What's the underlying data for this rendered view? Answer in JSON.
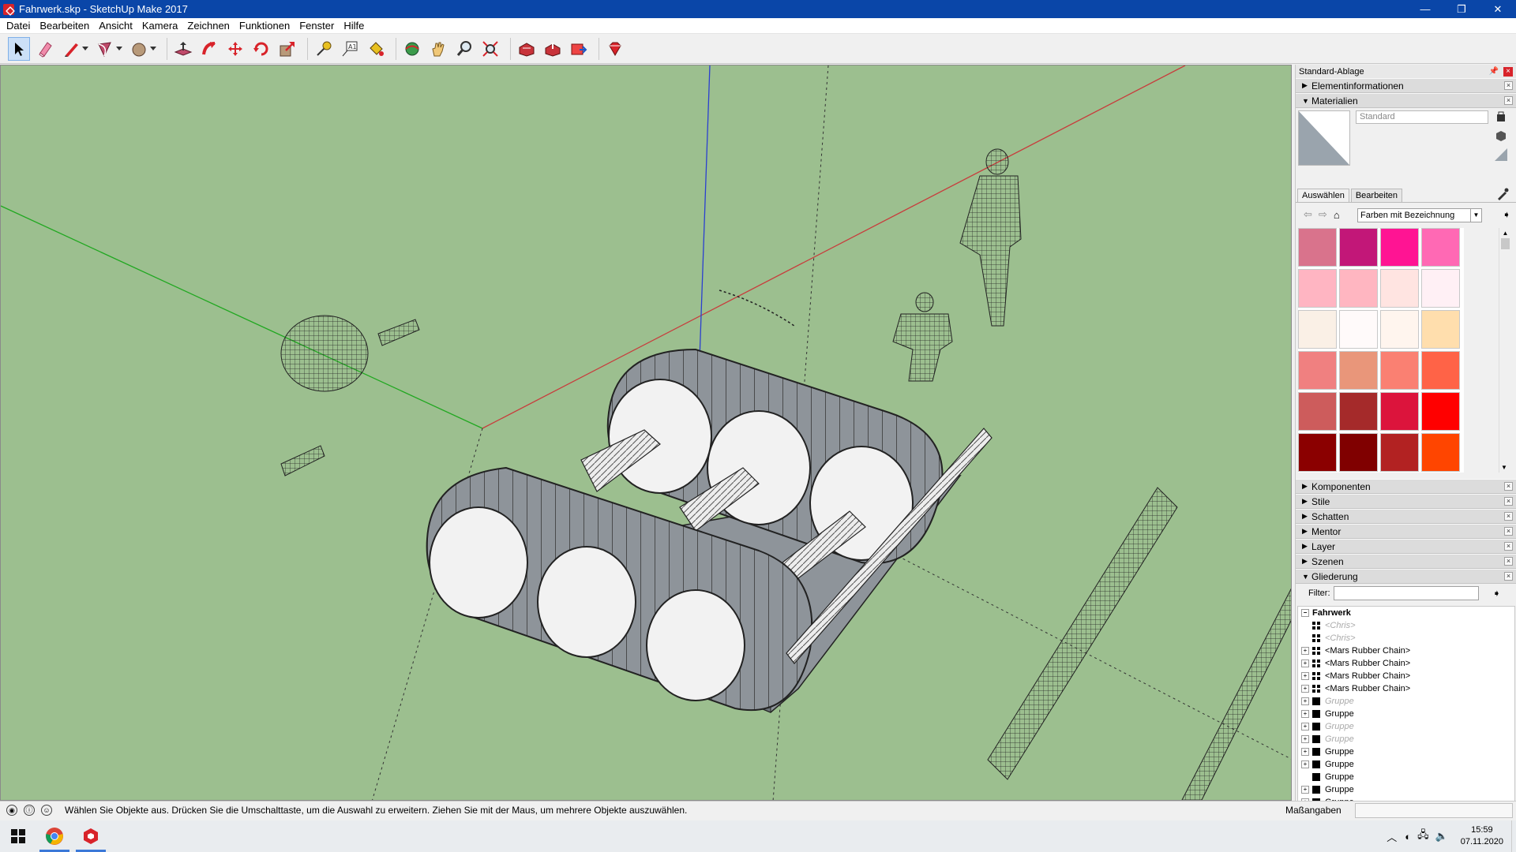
{
  "window": {
    "title": "Fahrwerk.skp - SketchUp Make 2017",
    "minimize": "—",
    "maximize": "❐",
    "close": "✕"
  },
  "menu": [
    "Datei",
    "Bearbeiten",
    "Ansicht",
    "Kamera",
    "Zeichnen",
    "Funktionen",
    "Fenster",
    "Hilfe"
  ],
  "tray": {
    "title": "Standard-Ablage",
    "panels": {
      "elementinfo": "Elementinformationen",
      "materialien": "Materialien",
      "komponenten": "Komponenten",
      "stile": "Stile",
      "schatten": "Schatten",
      "mentor": "Mentor",
      "layer": "Layer",
      "szenen": "Szenen",
      "gliederung": "Gliederung"
    },
    "material": {
      "name_placeholder": "Standard",
      "tab_select": "Auswählen",
      "tab_edit": "Bearbeiten",
      "library": "Farben mit Bezeichnung",
      "swatches": [
        "#d9738c",
        "#c21778",
        "#ff1493",
        "#ff69b4",
        "#ffb5c2",
        "#ffb6c1",
        "#ffe4e1",
        "#fff0f5",
        "#faf0e6",
        "#fffafa",
        "#fff5ee",
        "#ffdead",
        "#f08080",
        "#e9967a",
        "#fa8072",
        "#ff6347",
        "#cd5c5c",
        "#a52a2a",
        "#dc143c",
        "#ff0000",
        "#8b0000",
        "#800000",
        "#b22222",
        "#ff4500"
      ]
    },
    "outliner": {
      "filter_label": "Filter:",
      "root": "Fahrwerk",
      "items": [
        {
          "label": "<Chris>",
          "type": "comp",
          "hidden": true,
          "expandable": false
        },
        {
          "label": "<Chris>",
          "type": "comp",
          "hidden": true,
          "expandable": false
        },
        {
          "label": "<Mars Rubber Chain>",
          "type": "comp",
          "hidden": false,
          "expandable": true
        },
        {
          "label": "<Mars Rubber Chain>",
          "type": "comp",
          "hidden": false,
          "expandable": true
        },
        {
          "label": "<Mars Rubber Chain>",
          "type": "comp",
          "hidden": false,
          "expandable": true
        },
        {
          "label": "<Mars Rubber Chain>",
          "type": "comp",
          "hidden": false,
          "expandable": true
        },
        {
          "label": "Gruppe",
          "type": "group",
          "hidden": true,
          "expandable": true
        },
        {
          "label": "Gruppe",
          "type": "group",
          "hidden": false,
          "expandable": true
        },
        {
          "label": "Gruppe",
          "type": "group",
          "hidden": true,
          "expandable": true
        },
        {
          "label": "Gruppe",
          "type": "group",
          "hidden": true,
          "expandable": true
        },
        {
          "label": "Gruppe",
          "type": "group",
          "hidden": false,
          "expandable": true
        },
        {
          "label": "Gruppe",
          "type": "group",
          "hidden": false,
          "expandable": true
        },
        {
          "label": "Gruppe",
          "type": "group",
          "hidden": false,
          "expandable": false
        },
        {
          "label": "Gruppe",
          "type": "group",
          "hidden": false,
          "expandable": true
        },
        {
          "label": "Gruppe",
          "type": "group",
          "hidden": false,
          "expandable": true
        }
      ]
    }
  },
  "status": {
    "text": "Wählen Sie Objekte aus. Drücken Sie die Umschalttaste, um die Auswahl zu erweitern. Ziehen Sie mit der Maus, um mehrere Objekte auszuwählen.",
    "measure_label": "Maßangaben"
  },
  "taskbar": {
    "time": "15:59",
    "date": "07.11.2020"
  },
  "colors": {
    "sky_ground": "#9cbf8f",
    "titlebar": "#0a46a8",
    "axis_red": "#c83c3c",
    "axis_green": "#21a821",
    "axis_blue": "#2b3fd0"
  }
}
